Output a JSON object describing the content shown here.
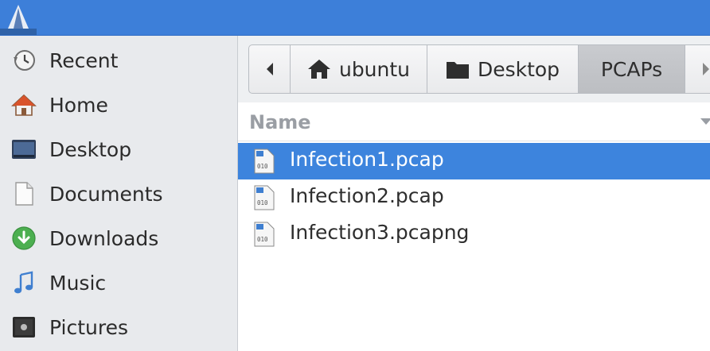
{
  "sidebar": {
    "items": [
      {
        "label": "Recent",
        "icon": "clock-icon"
      },
      {
        "label": "Home",
        "icon": "home-icon"
      },
      {
        "label": "Desktop",
        "icon": "desktop-icon"
      },
      {
        "label": "Documents",
        "icon": "document-icon"
      },
      {
        "label": "Downloads",
        "icon": "download-icon"
      },
      {
        "label": "Music",
        "icon": "music-note-icon"
      },
      {
        "label": "Pictures",
        "icon": "pictures-icon"
      }
    ]
  },
  "pathbar": {
    "segments": [
      {
        "label": "ubuntu",
        "icon": "home-icon"
      },
      {
        "label": "Desktop",
        "icon": "folder-icon"
      },
      {
        "label": "PCAPs",
        "active": true
      }
    ]
  },
  "file_list": {
    "column_header": "Name",
    "files": [
      {
        "name": "Infection1.pcap",
        "selected": true
      },
      {
        "name": "Infection2.pcap",
        "selected": false
      },
      {
        "name": "Infection3.pcapng",
        "selected": false
      }
    ]
  },
  "colors": {
    "titlebar": "#3d7fd9",
    "selection": "#3d84dd",
    "sidebar_bg": "#e8eaed"
  }
}
